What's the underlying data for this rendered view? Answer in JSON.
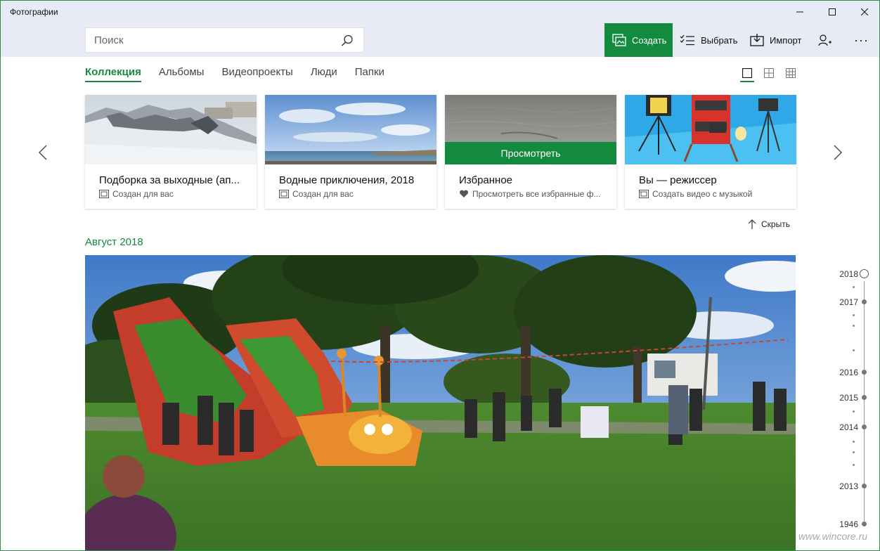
{
  "window": {
    "title": "Фотографии"
  },
  "search": {
    "placeholder": "Поиск"
  },
  "toolbar": {
    "create_label": "Создать",
    "select_label": "Выбрать",
    "import_label": "Импорт",
    "more_label": "···"
  },
  "tabs": [
    {
      "label": "Коллекция",
      "active": true
    },
    {
      "label": "Альбомы"
    },
    {
      "label": "Видеопроекты"
    },
    {
      "label": "Люди"
    },
    {
      "label": "Папки"
    }
  ],
  "cards": [
    {
      "title": "Подборка за выходные (ап...",
      "subtitle": "Создан для вас",
      "icon": "album-icon"
    },
    {
      "title": "Водные приключения, 2018",
      "subtitle": "Создан для вас",
      "icon": "album-icon"
    },
    {
      "title": "Избранное",
      "subtitle": "Просмотреть все избранные ф...",
      "icon": "heart-icon",
      "overlay": "Просмотреть"
    },
    {
      "title": "Вы — режиссер",
      "subtitle": "Создать видео с музыкой",
      "icon": "video-icon"
    }
  ],
  "hide_label": "Скрыть",
  "section": {
    "month": "Август 2018"
  },
  "timeline": {
    "years": [
      "2018",
      "2017",
      "2016",
      "2015",
      "2014",
      "2013",
      "1946"
    ],
    "current": "2018"
  },
  "watermark": "www.wincore.ru",
  "colors": {
    "accent": "#148a3f",
    "titlebar": "#e8ebf5",
    "border": "#2c8d4b"
  }
}
